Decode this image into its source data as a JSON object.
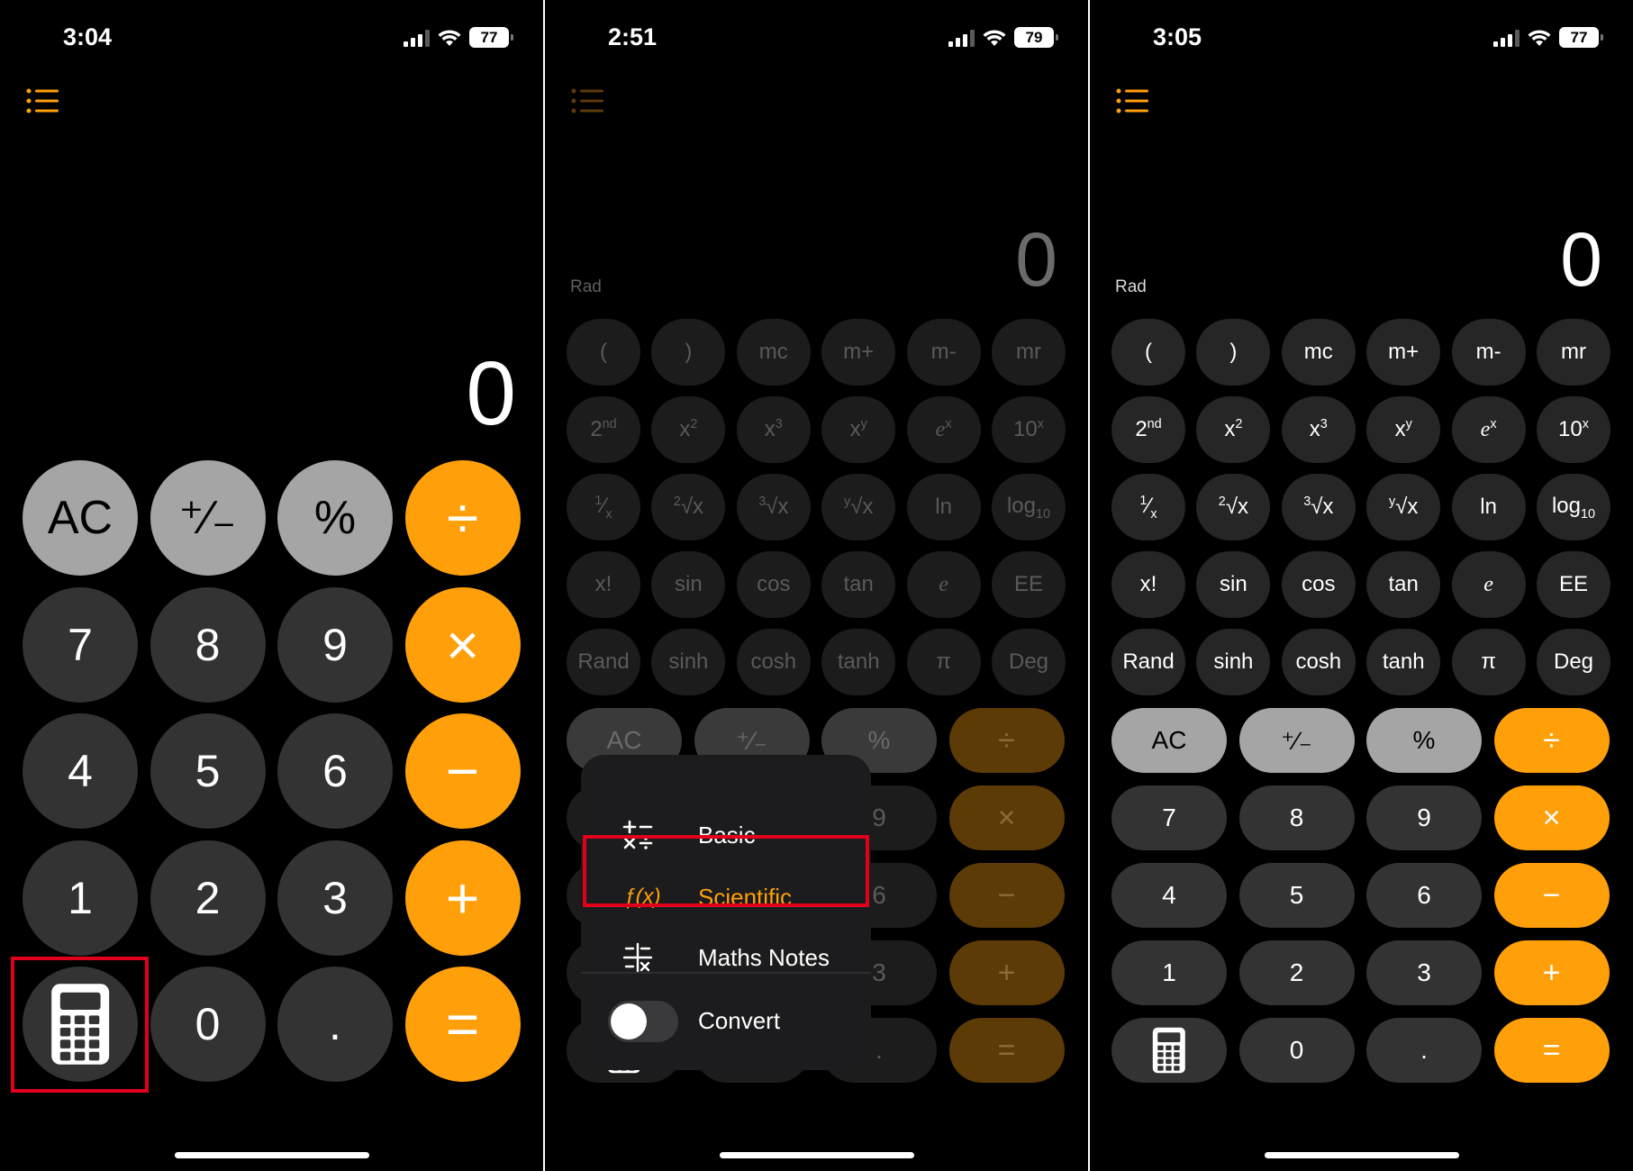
{
  "colors": {
    "accent": "#ff9f0a",
    "highlight_box": "#e0001b"
  },
  "screens": [
    {
      "status": {
        "time": "3:04",
        "battery": "77"
      },
      "display": "0",
      "keys": [
        [
          "AC",
          "⁺∕₋",
          "%",
          "÷"
        ],
        [
          "7",
          "8",
          "9",
          "×"
        ],
        [
          "4",
          "5",
          "6",
          "−"
        ],
        [
          "1",
          "2",
          "3",
          "+"
        ],
        [
          "calculator-icon",
          "0",
          ".",
          "="
        ]
      ]
    },
    {
      "status": {
        "time": "2:51",
        "battery": "79"
      },
      "display": "0",
      "angle_mode": "Rad",
      "popup": {
        "items": [
          {
            "label": "Basic",
            "icon": "basic-operations-icon"
          },
          {
            "label": "Scientific",
            "icon": "function-icon",
            "glyph": "ƒ(x)"
          },
          {
            "label": "Maths Notes",
            "icon": "maths-notes-icon"
          }
        ],
        "convert_label": "Convert"
      }
    },
    {
      "status": {
        "time": "3:05",
        "battery": "77"
      },
      "display": "0",
      "angle_mode": "Rad"
    }
  ],
  "scientific_keys": [
    [
      "(",
      ")",
      "mc",
      "m+",
      "m-",
      "mr"
    ],
    [
      "2nd",
      "x2",
      "x3",
      "xy",
      "ex",
      "10x"
    ],
    [
      "1/x",
      "2√x",
      "3√x",
      "y√x",
      "ln",
      "log10"
    ],
    [
      "x!",
      "sin",
      "cos",
      "tan",
      "e",
      "EE"
    ],
    [
      "Rand",
      "sinh",
      "cosh",
      "tanh",
      "π",
      "Deg"
    ]
  ],
  "scientific_labels_display": {
    "2nd": "2<sup>nd</sup>",
    "x2": "x<sup>2</sup>",
    "x3": "x<sup>3</sup>",
    "xy": "x<sup>y</sup>",
    "ex": "<i style='font-family:\"Liberation Serif\",serif'>e</i><sup>x</sup>",
    "10x": "10<sup>x</sup>",
    "1/x": "<sup>1</sup>⁄<sub>x</sub>",
    "2√x": "<sup>2</sup>√x",
    "3√x": "<sup>3</sup>√x",
    "y√x": "<sup>y</sup>√x",
    "log10": "log<sub>10</sub>",
    "e": "<i style='font-family:\"Liberation Serif\",serif'>e</i>"
  },
  "basic_keys_small": [
    [
      "AC",
      "⁺∕₋",
      "%",
      "÷"
    ],
    [
      "7",
      "8",
      "9",
      "×"
    ],
    [
      "4",
      "5",
      "6",
      "−"
    ],
    [
      "1",
      "2",
      "3",
      "+"
    ],
    [
      "calculator-icon",
      "0",
      ".",
      "="
    ]
  ]
}
